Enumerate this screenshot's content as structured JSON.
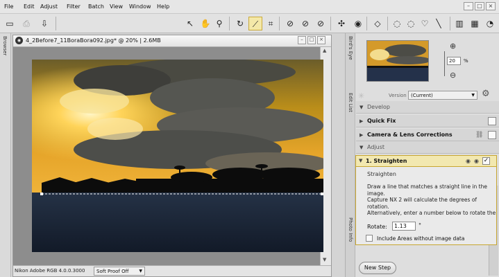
{
  "menu": {
    "items": [
      "File",
      "Edit",
      "Adjust",
      "Filter",
      "Batch",
      "View",
      "Window",
      "Help"
    ]
  },
  "document": {
    "title": "4_2Before7_11BoraBora092.jpg* @ 20% | 2.6MB",
    "color_profile": "Nikon Adobe RGB 4.0.0.3000",
    "soft_proof": "Soft Proof Off"
  },
  "left_panel": {
    "browser_tab": "Browser"
  },
  "birds_eye": {
    "tab_label": "Bird's Eye",
    "zoom_value": "20",
    "zoom_unit": "%"
  },
  "edit_list": {
    "tab_label": "Edit List",
    "version_label": "Version",
    "version_value": "(Current)",
    "develop_label": "Develop",
    "quick_fix_label": "Quick Fix",
    "camera_label": "Camera & Lens Corrections",
    "adjust_label": "Adjust",
    "step_title": "1. Straighten",
    "step_subtitle": "Straighten",
    "description": "Draw a line that matches a straight line in the image.\nCapture NX 2 will calculate the degrees of rotation.\nAlternatively, enter a number below to rotate the image by that amount.",
    "rotate_label": "Rotate:",
    "rotate_value": "1.13",
    "rotate_unit": "°",
    "include_label": "Include Areas without image data",
    "new_step_label": "New Step"
  },
  "photo_info": {
    "tab_label": "Photo Info"
  }
}
